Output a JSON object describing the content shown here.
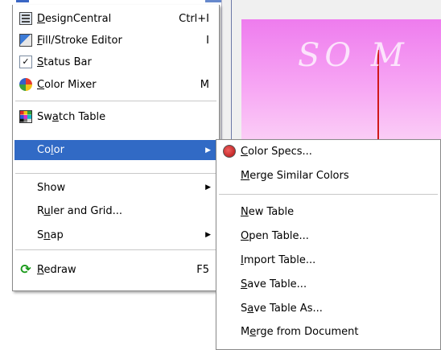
{
  "document": {
    "canvas_text": "SO M"
  },
  "main_menu": {
    "items": [
      {
        "id": "designcentral",
        "pre": "",
        "u": "D",
        "post": "esignCentral",
        "shortcut": "Ctrl+I",
        "icon": "designcentral-icon"
      },
      {
        "id": "fill-stroke-editor",
        "pre": "",
        "u": "F",
        "post": "ill/Stroke Editor",
        "shortcut": "I",
        "icon": "fill-stroke-icon"
      },
      {
        "id": "status-bar",
        "pre": "",
        "u": "S",
        "post": "tatus Bar",
        "shortcut": "",
        "icon": "checkmark-icon",
        "check": "✓"
      },
      {
        "id": "color-mixer",
        "pre": "",
        "u": "C",
        "post": "olor Mixer",
        "shortcut": "M",
        "icon": "color-mixer-icon"
      },
      {
        "id": "swatch-table",
        "pre": "Sw",
        "u": "a",
        "post": "tch Table",
        "shortcut": "",
        "icon": "swatch-table-icon"
      },
      {
        "id": "color",
        "pre": "Co",
        "u": "l",
        "post": "or",
        "shortcut": "",
        "submenu": true
      },
      {
        "id": "show",
        "pre": "Show",
        "u": "",
        "post": "",
        "shortcut": "",
        "submenu": true
      },
      {
        "id": "ruler-and-grid",
        "pre": "R",
        "u": "u",
        "post": "ler and Grid...",
        "shortcut": ""
      },
      {
        "id": "snap",
        "pre": "S",
        "u": "n",
        "post": "ap",
        "shortcut": "",
        "submenu": true
      },
      {
        "id": "redraw",
        "pre": "",
        "u": "R",
        "post": "edraw",
        "shortcut": "F5",
        "icon": "redraw-icon",
        "glyph": "⟳"
      }
    ],
    "arrow": "▶"
  },
  "color_submenu": {
    "items": [
      {
        "id": "color-specs",
        "pre": "",
        "u": "C",
        "post": "olor Specs...",
        "icon": "color-specs-icon"
      },
      {
        "id": "merge-similar-colors",
        "pre": "",
        "u": "M",
        "post": "erge Similar Colors"
      },
      {
        "id": "new-table",
        "pre": "",
        "u": "N",
        "post": "ew Table"
      },
      {
        "id": "open-table",
        "pre": "",
        "u": "O",
        "post": "pen Table..."
      },
      {
        "id": "import-table",
        "pre": "",
        "u": "I",
        "post": "mport Table..."
      },
      {
        "id": "save-table",
        "pre": "",
        "u": "S",
        "post": "ave Table..."
      },
      {
        "id": "save-table-as",
        "pre": "S",
        "u": "a",
        "post": "ve Table As..."
      },
      {
        "id": "merge-from-document",
        "pre": "M",
        "u": "e",
        "post": "rge from Document"
      }
    ]
  },
  "colors": {
    "highlight": "#316ac5",
    "menu_bg": "#ffffff",
    "page_pink": "#ee7cee"
  }
}
